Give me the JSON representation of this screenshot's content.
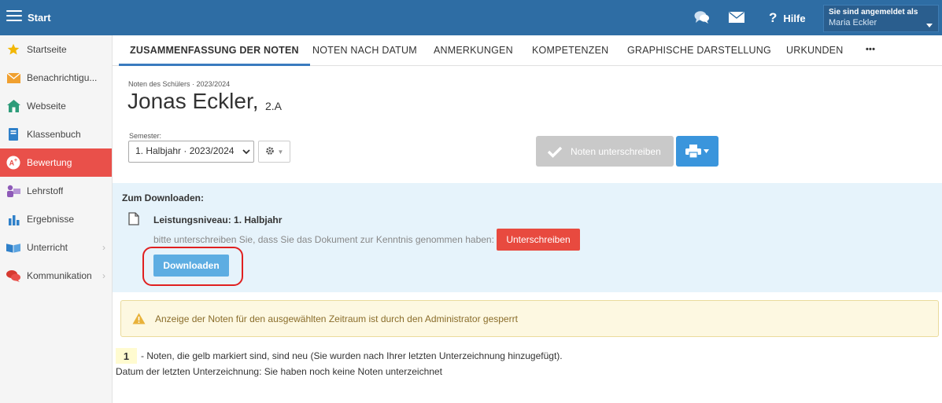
{
  "app": {
    "title": "Start"
  },
  "header": {
    "help_label": "Hilfe",
    "help_mark": "?",
    "user_caption": "Sie sind angemeldet als",
    "user_name": "Maria Eckler"
  },
  "sidebar": {
    "items": [
      {
        "label": "Startseite",
        "icon": "star-icon"
      },
      {
        "label": "Benachrichtigu...",
        "icon": "envelope-icon"
      },
      {
        "label": "Webseite",
        "icon": "house-icon"
      },
      {
        "label": "Klassenbuch",
        "icon": "book-icon"
      },
      {
        "label": "Bewertung",
        "icon": "grade-icon",
        "active": true
      },
      {
        "label": "Lehrstoff",
        "icon": "teacher-icon"
      },
      {
        "label": "Ergebnisse",
        "icon": "bar-chart-icon"
      },
      {
        "label": "Unterricht",
        "icon": "open-book-icon",
        "arrow": "›"
      },
      {
        "label": "Kommunikation",
        "icon": "chat-bubbles-icon",
        "arrow": "›"
      }
    ]
  },
  "tabs": [
    {
      "label": "ZUSAMMENFASSUNG DER NOTEN",
      "active": true
    },
    {
      "label": "NOTEN NACH DATUM"
    },
    {
      "label": "ANMERKUNGEN"
    },
    {
      "label": "KOMPETENZEN"
    },
    {
      "label": "GRAPHISCHE DARSTELLUNG"
    },
    {
      "label": "URKUNDEN"
    },
    {
      "label": "•••"
    }
  ],
  "student": {
    "subtitle": "Noten des Schülers · 2023/2024",
    "name": "Jonas Eckler,",
    "class": "2.A"
  },
  "semester": {
    "label": "Semester:",
    "selected": "1. Halbjahr · 2023/2024"
  },
  "actions": {
    "sign_label": "Noten unterschreiben"
  },
  "download": {
    "title": "Zum Downloaden:",
    "document_name": "Leistungsniveau: 1. Halbjahr",
    "hint": "bitte unterschreiben Sie, dass Sie das Dokument zur Kenntnis genommen haben:",
    "sign_button": "Unterschreiben",
    "download_button": "Downloaden"
  },
  "warning": {
    "text": "Anzeige der Noten für den ausgewählten Zeitraum ist durch den Administrator gesperrt"
  },
  "legend": {
    "badge": "1",
    "text": "- Noten, die gelb markiert sind, sind neu (Sie wurden nach Ihrer letzten Unterzeichnung hinzugefügt).",
    "last_signature": "Datum der letzten Unterzeichnung: Sie haben noch keine Noten unterzeichnet"
  },
  "colors": {
    "topbar": "#2e6da4",
    "active_sidebar": "#e9504a",
    "download_panel": "#e6f3fb",
    "sign_red": "#e84a3f",
    "download_blue": "#5dade2",
    "highlight_circle": "#e02020"
  }
}
